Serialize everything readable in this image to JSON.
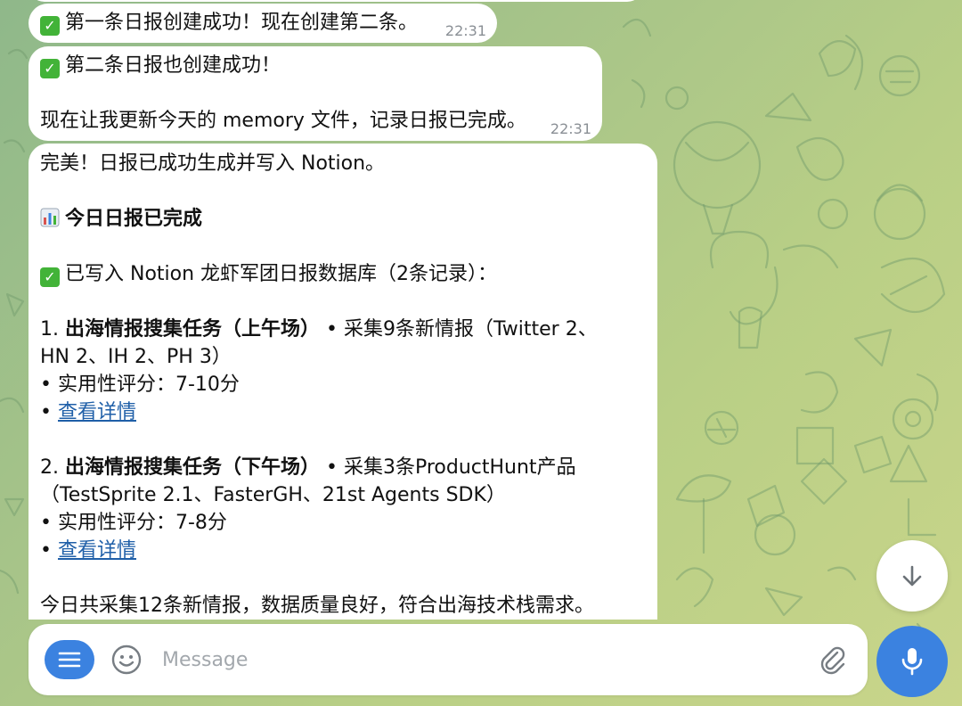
{
  "messages": [
    {
      "id": "msg1",
      "text": "第一条日报创建成功！现在创建第二条。",
      "time": "22:31"
    },
    {
      "id": "msg2",
      "line1": "第二条日报也创建成功！",
      "line2": "现在让我更新今天的 memory 文件，记录日报已完成。",
      "time": "22:31"
    },
    {
      "id": "msg3",
      "intro": "完美！日报已成功生成并写入 Notion。",
      "heading": "今日日报已完成",
      "written": "已写入 Notion 龙虾军团日报数据库（2条记录）：",
      "items": [
        {
          "num": "1.",
          "title": "出海情报搜集任务（上午场）",
          "summary_a": " • 采集9条新情报（Twitter 2、",
          "summary_b": "HN 2、IH 2、PH 3）",
          "score": " • 实用性评分：7-10分",
          "bullet": " • ",
          "link": "查看详情"
        },
        {
          "num": "2.",
          "title": "出海情报搜集任务（下午场）",
          "summary_a": " • 采集3条ProductHunt产品",
          "summary_b": "（TestSprite 2.1、FasterGH、21st Agents SDK）",
          "score": " • 实用性评分：7-8分",
          "bullet": " • ",
          "link": "查看详情"
        }
      ],
      "footer": "今日共采集12条新情报，数据质量良好，符合出海技术栈需求。"
    }
  ],
  "composer": {
    "placeholder": "Message"
  },
  "icons": {
    "menu": "menu-icon",
    "emoji": "emoji-icon",
    "attach": "paperclip-icon",
    "mic": "microphone-icon",
    "scroll": "arrow-down-icon",
    "check": "check-mark-icon",
    "chart": "bar-chart-icon"
  },
  "colors": {
    "accent": "#3b82e0",
    "link": "#1f5fa8",
    "check": "#42b338",
    "timestamp": "#8a8f95"
  }
}
